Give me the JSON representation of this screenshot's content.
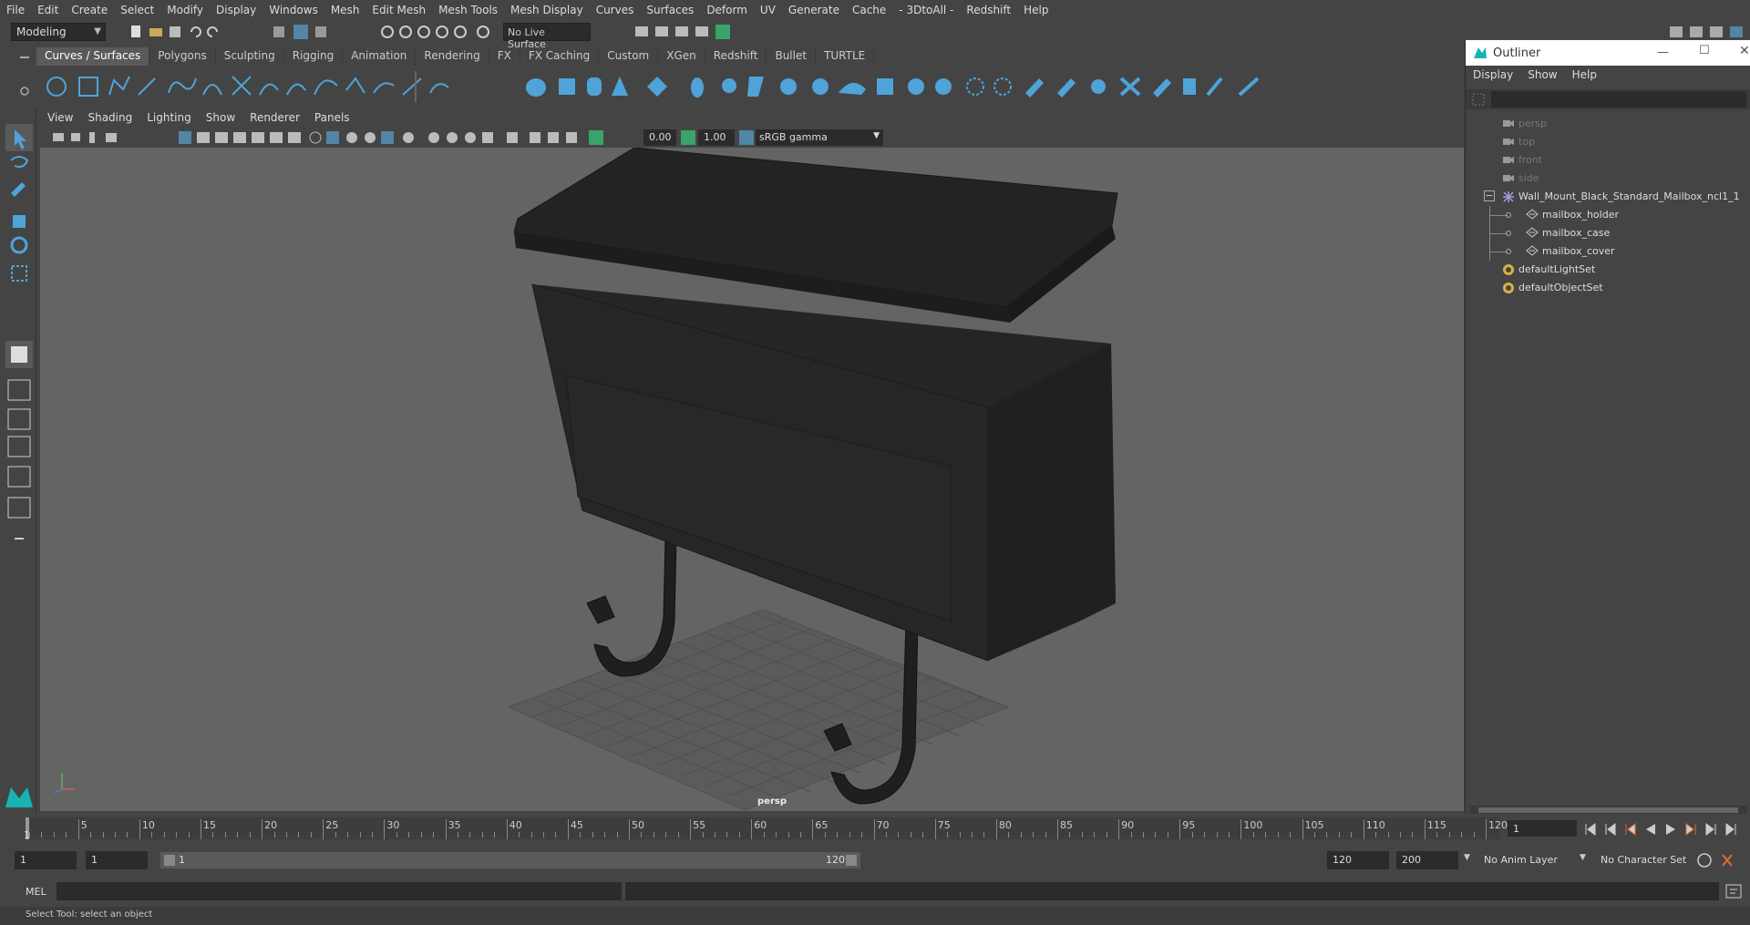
{
  "menubar": [
    "File",
    "Edit",
    "Create",
    "Select",
    "Modify",
    "Display",
    "Windows",
    "Mesh",
    "Edit Mesh",
    "Mesh Tools",
    "Mesh Display",
    "Curves",
    "Surfaces",
    "Deform",
    "UV",
    "Generate",
    "Cache",
    "- 3DtoAll -",
    "Redshift",
    "Help"
  ],
  "status_line": {
    "mode": "Modeling",
    "live_surface": "No Live Surface"
  },
  "shelf_tabs": [
    "Curves / Surfaces",
    "Polygons",
    "Sculpting",
    "Rigging",
    "Animation",
    "Rendering",
    "FX",
    "FX Caching",
    "Custom",
    "XGen",
    "Redshift",
    "Bullet",
    "TURTLE"
  ],
  "shelf_active": "Curves / Surfaces",
  "viewport": {
    "menu": [
      "View",
      "Shading",
      "Lighting",
      "Show",
      "Renderer",
      "Panels"
    ],
    "exposure": "0.00",
    "gamma": "1.00",
    "colorspace": "sRGB gamma",
    "camera_label": "persp"
  },
  "outliner": {
    "title": "Outliner",
    "menu": [
      "Display",
      "Show",
      "Help"
    ],
    "items": [
      {
        "label": "persp",
        "type": "camera",
        "depth": 0,
        "dim": true
      },
      {
        "label": "top",
        "type": "camera",
        "depth": 0,
        "dim": true
      },
      {
        "label": "front",
        "type": "camera",
        "depth": 0,
        "dim": true
      },
      {
        "label": "side",
        "type": "camera",
        "depth": 0,
        "dim": true
      },
      {
        "label": "Wall_Mount_Black_Standard_Mailbox_ncl1_1",
        "type": "group",
        "depth": 0,
        "dim": false
      },
      {
        "label": "mailbox_holder",
        "type": "mesh",
        "depth": 1,
        "dim": false
      },
      {
        "label": "mailbox_case",
        "type": "mesh",
        "depth": 1,
        "dim": false
      },
      {
        "label": "mailbox_cover",
        "type": "mesh",
        "depth": 1,
        "dim": false
      },
      {
        "label": "defaultLightSet",
        "type": "set",
        "depth": 0,
        "dim": false
      },
      {
        "label": "defaultObjectSet",
        "type": "set",
        "depth": 0,
        "dim": false
      }
    ]
  },
  "timeline": {
    "ticks": [
      "5",
      "10",
      "15",
      "20",
      "25",
      "30",
      "35",
      "40",
      "45",
      "50",
      "55",
      "60",
      "65",
      "70",
      "75",
      "80",
      "85",
      "90",
      "95",
      "100",
      "105",
      "110",
      "115",
      "120"
    ],
    "current_frame": "1",
    "current_frame_field": "1"
  },
  "range": {
    "start": "1",
    "anim_start": "1",
    "slider_start": "1",
    "slider_end": "120",
    "end": "120",
    "anim_end": "200",
    "anim_layer": "No Anim Layer",
    "character_set": "No Character Set"
  },
  "command_line": {
    "label": "MEL"
  },
  "help_line": "Select Tool: select an object",
  "colors": {
    "accent": "#5285a6",
    "viewport_bg": "#646464",
    "ui_bg": "#444444",
    "field_bg": "#2b2b2b"
  }
}
